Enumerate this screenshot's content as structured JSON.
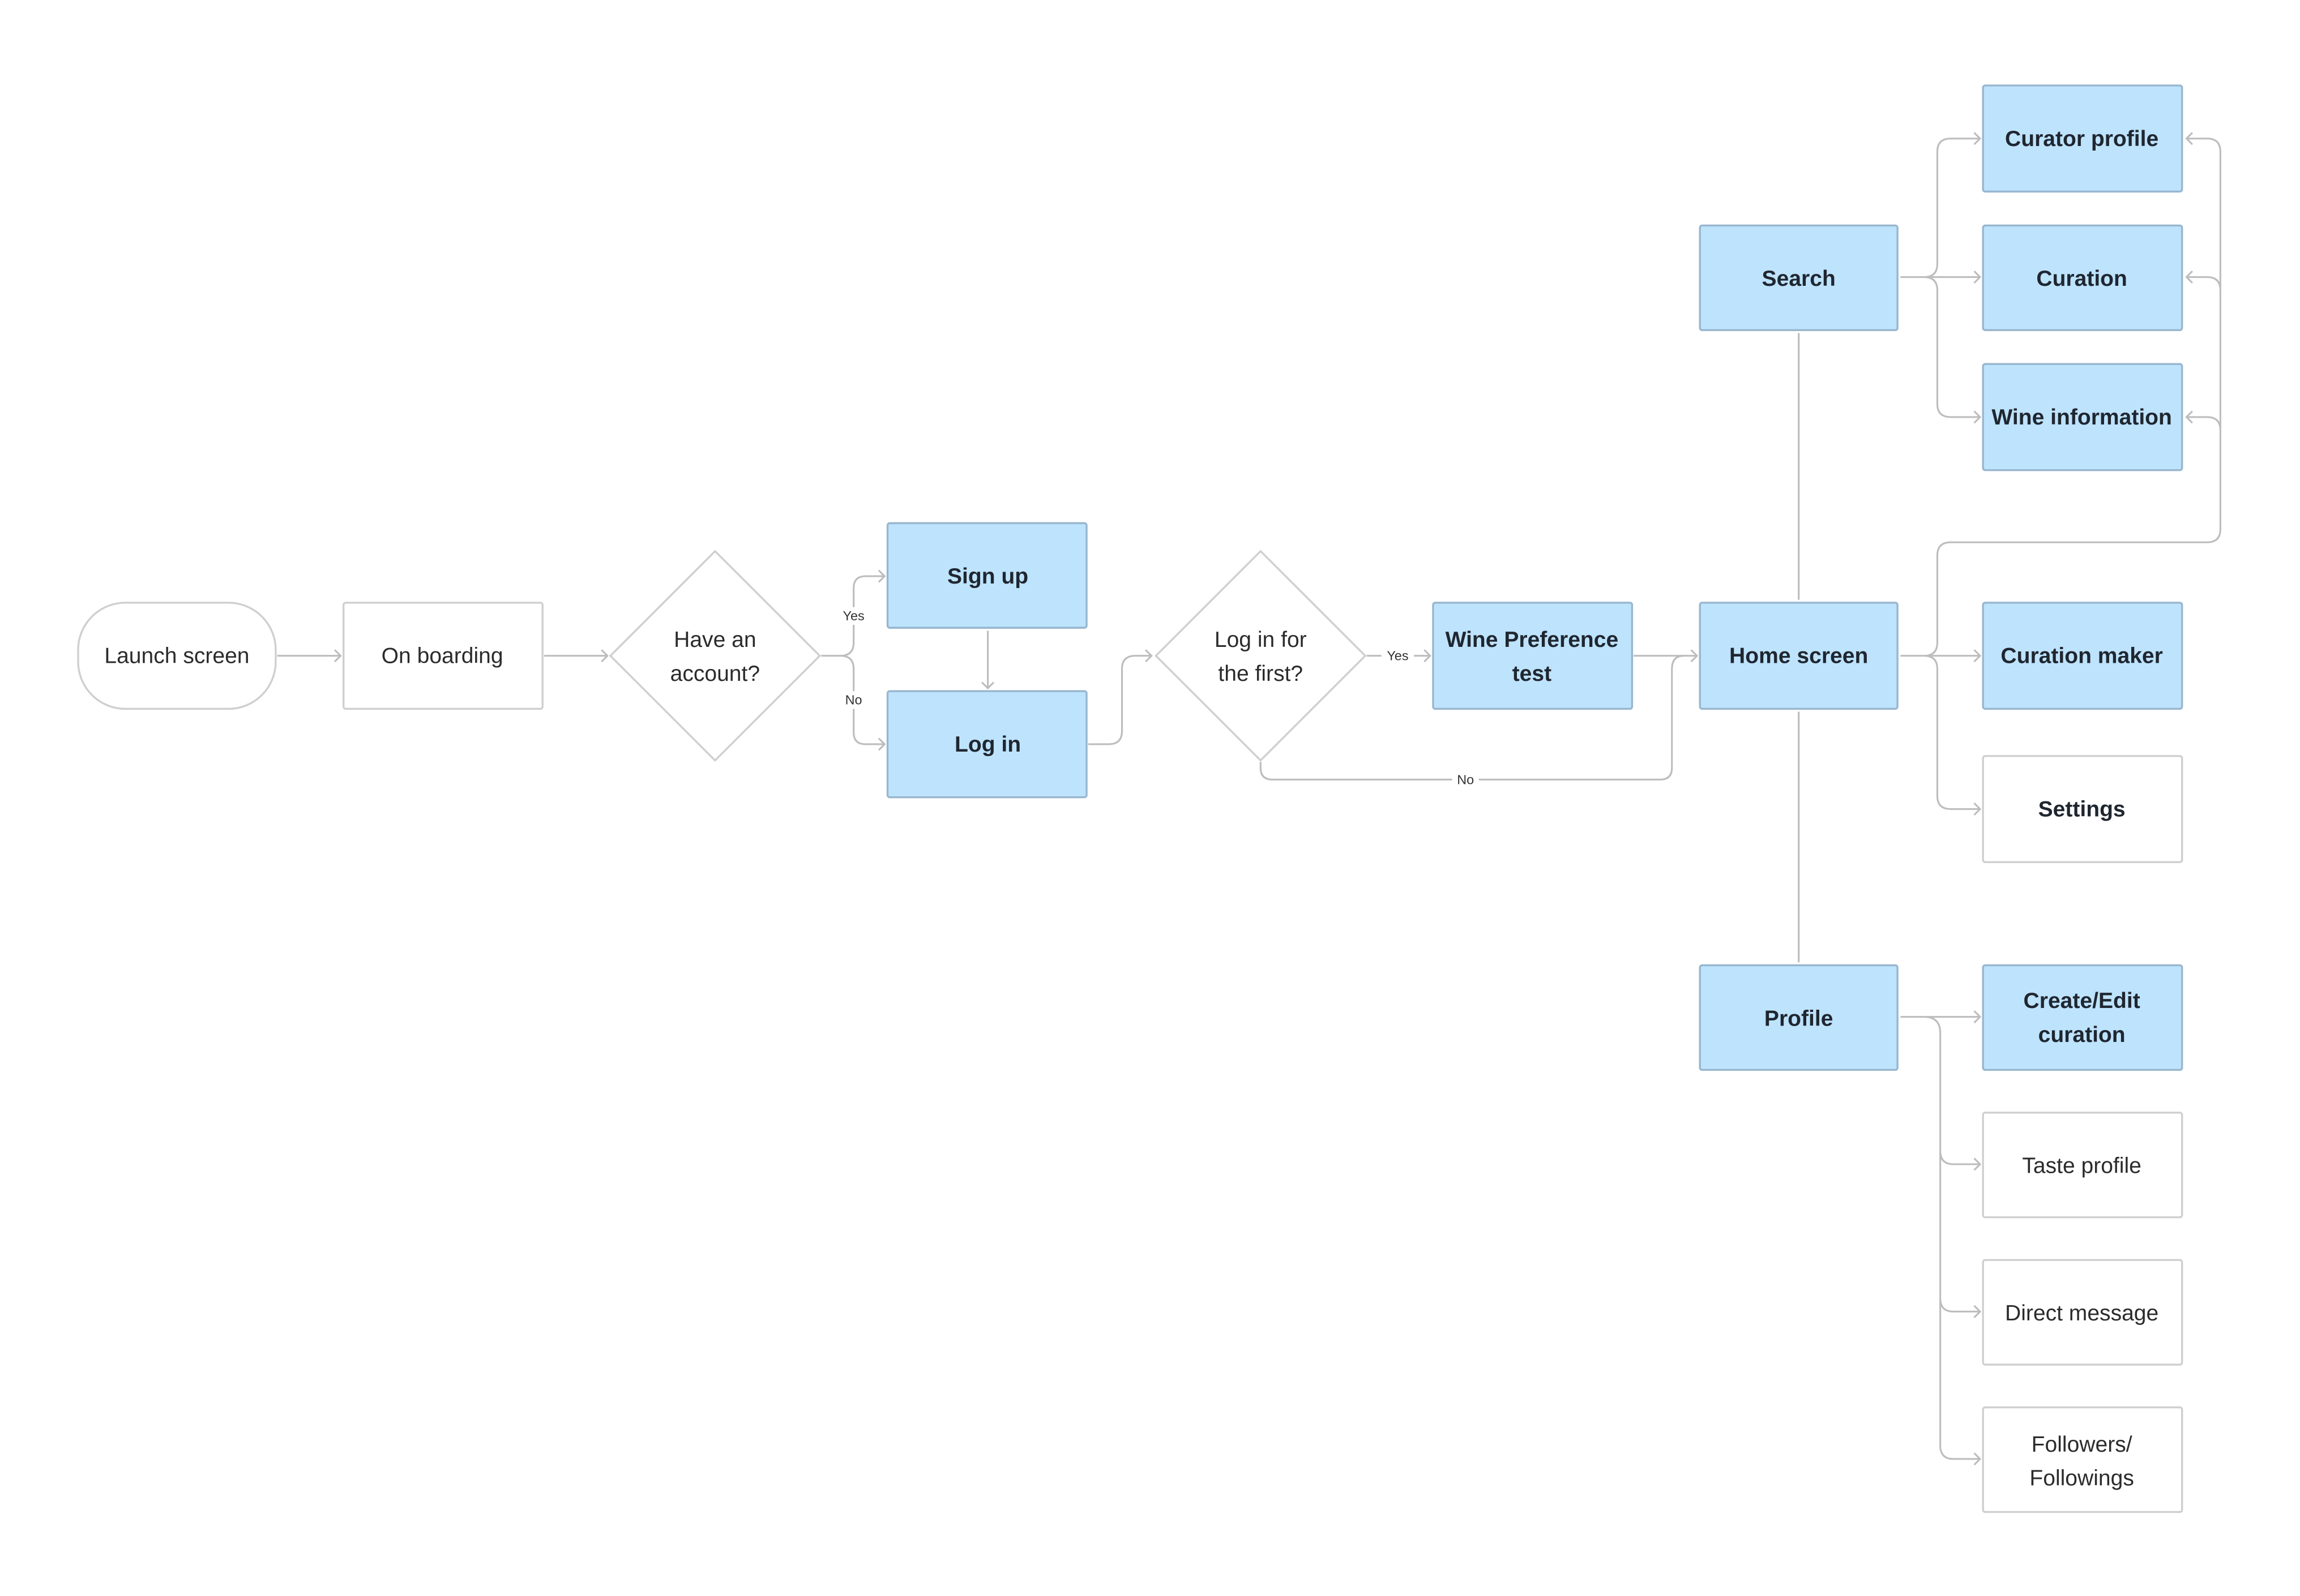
{
  "diagram": {
    "type": "user-flow",
    "colors": {
      "screen_fill": "#BEE3FD",
      "screen_border": "#98B6CF",
      "plain_fill": "#FFFFFF",
      "plain_border": "#CFCFCF",
      "connector": "#BDBDBD",
      "text": "#1F2630"
    },
    "nodes": {
      "launch": {
        "label": [
          "Launch screen"
        ],
        "kind": "terminal",
        "style": "plain"
      },
      "onboarding": {
        "label": [
          "On boarding"
        ],
        "kind": "process",
        "style": "plain"
      },
      "have_account": {
        "label": [
          "Have an",
          "account?"
        ],
        "kind": "decision",
        "style": "plain"
      },
      "signup": {
        "label": [
          "Sign up"
        ],
        "kind": "process",
        "style": "screen"
      },
      "login": {
        "label": [
          "Log in"
        ],
        "kind": "process",
        "style": "screen"
      },
      "first_login": {
        "label": [
          "Log in for",
          "the first?"
        ],
        "kind": "decision",
        "style": "plain"
      },
      "wine_pref": {
        "label": [
          "Wine Preference",
          "test"
        ],
        "kind": "process",
        "style": "screen"
      },
      "home": {
        "label": [
          "Home screen"
        ],
        "kind": "process",
        "style": "screen"
      },
      "search": {
        "label": [
          "Search"
        ],
        "kind": "process",
        "style": "screen"
      },
      "profile": {
        "label": [
          "Profile"
        ],
        "kind": "process",
        "style": "screen"
      },
      "curator_profile": {
        "label": [
          "Curator profile"
        ],
        "kind": "process",
        "style": "screen"
      },
      "curation": {
        "label": [
          "Curation"
        ],
        "kind": "process",
        "style": "screen"
      },
      "wine_info": {
        "label": [
          "Wine information"
        ],
        "kind": "process",
        "style": "screen"
      },
      "curation_maker": {
        "label": [
          "Curation maker"
        ],
        "kind": "process",
        "style": "screen"
      },
      "settings": {
        "label": [
          "Settings"
        ],
        "kind": "process",
        "style": "plain-bold"
      },
      "create_edit": {
        "label": [
          "Create/Edit",
          "curation"
        ],
        "kind": "process",
        "style": "screen"
      },
      "taste_profile": {
        "label": [
          "Taste profile"
        ],
        "kind": "process",
        "style": "plain"
      },
      "direct_message": {
        "label": [
          "Direct message"
        ],
        "kind": "process",
        "style": "plain"
      },
      "followers": {
        "label": [
          "Followers/",
          "Followings"
        ],
        "kind": "process",
        "style": "plain"
      }
    },
    "edge_labels": {
      "have_account_yes": "Yes",
      "have_account_no": "No",
      "first_login_yes": "Yes",
      "first_login_no": "No"
    },
    "edges": [
      {
        "from": "launch",
        "to": "onboarding"
      },
      {
        "from": "onboarding",
        "to": "have_account"
      },
      {
        "from": "have_account",
        "to": "signup",
        "label": "Yes"
      },
      {
        "from": "have_account",
        "to": "login",
        "label": "No"
      },
      {
        "from": "signup",
        "to": "login"
      },
      {
        "from": "login",
        "to": "first_login"
      },
      {
        "from": "first_login",
        "to": "wine_pref",
        "label": "Yes"
      },
      {
        "from": "first_login",
        "to": "home",
        "label": "No"
      },
      {
        "from": "wine_pref",
        "to": "home"
      },
      {
        "from": "home",
        "to": "search"
      },
      {
        "from": "home",
        "to": "profile"
      },
      {
        "from": "search",
        "to": "curator_profile"
      },
      {
        "from": "search",
        "to": "curation"
      },
      {
        "from": "search",
        "to": "wine_info"
      },
      {
        "from": "home",
        "to": "curator_profile"
      },
      {
        "from": "home",
        "to": "curation"
      },
      {
        "from": "home",
        "to": "wine_info"
      },
      {
        "from": "home",
        "to": "curation_maker"
      },
      {
        "from": "home",
        "to": "settings"
      },
      {
        "from": "profile",
        "to": "create_edit"
      },
      {
        "from": "profile",
        "to": "taste_profile"
      },
      {
        "from": "profile",
        "to": "direct_message"
      },
      {
        "from": "profile",
        "to": "followers"
      }
    ]
  }
}
